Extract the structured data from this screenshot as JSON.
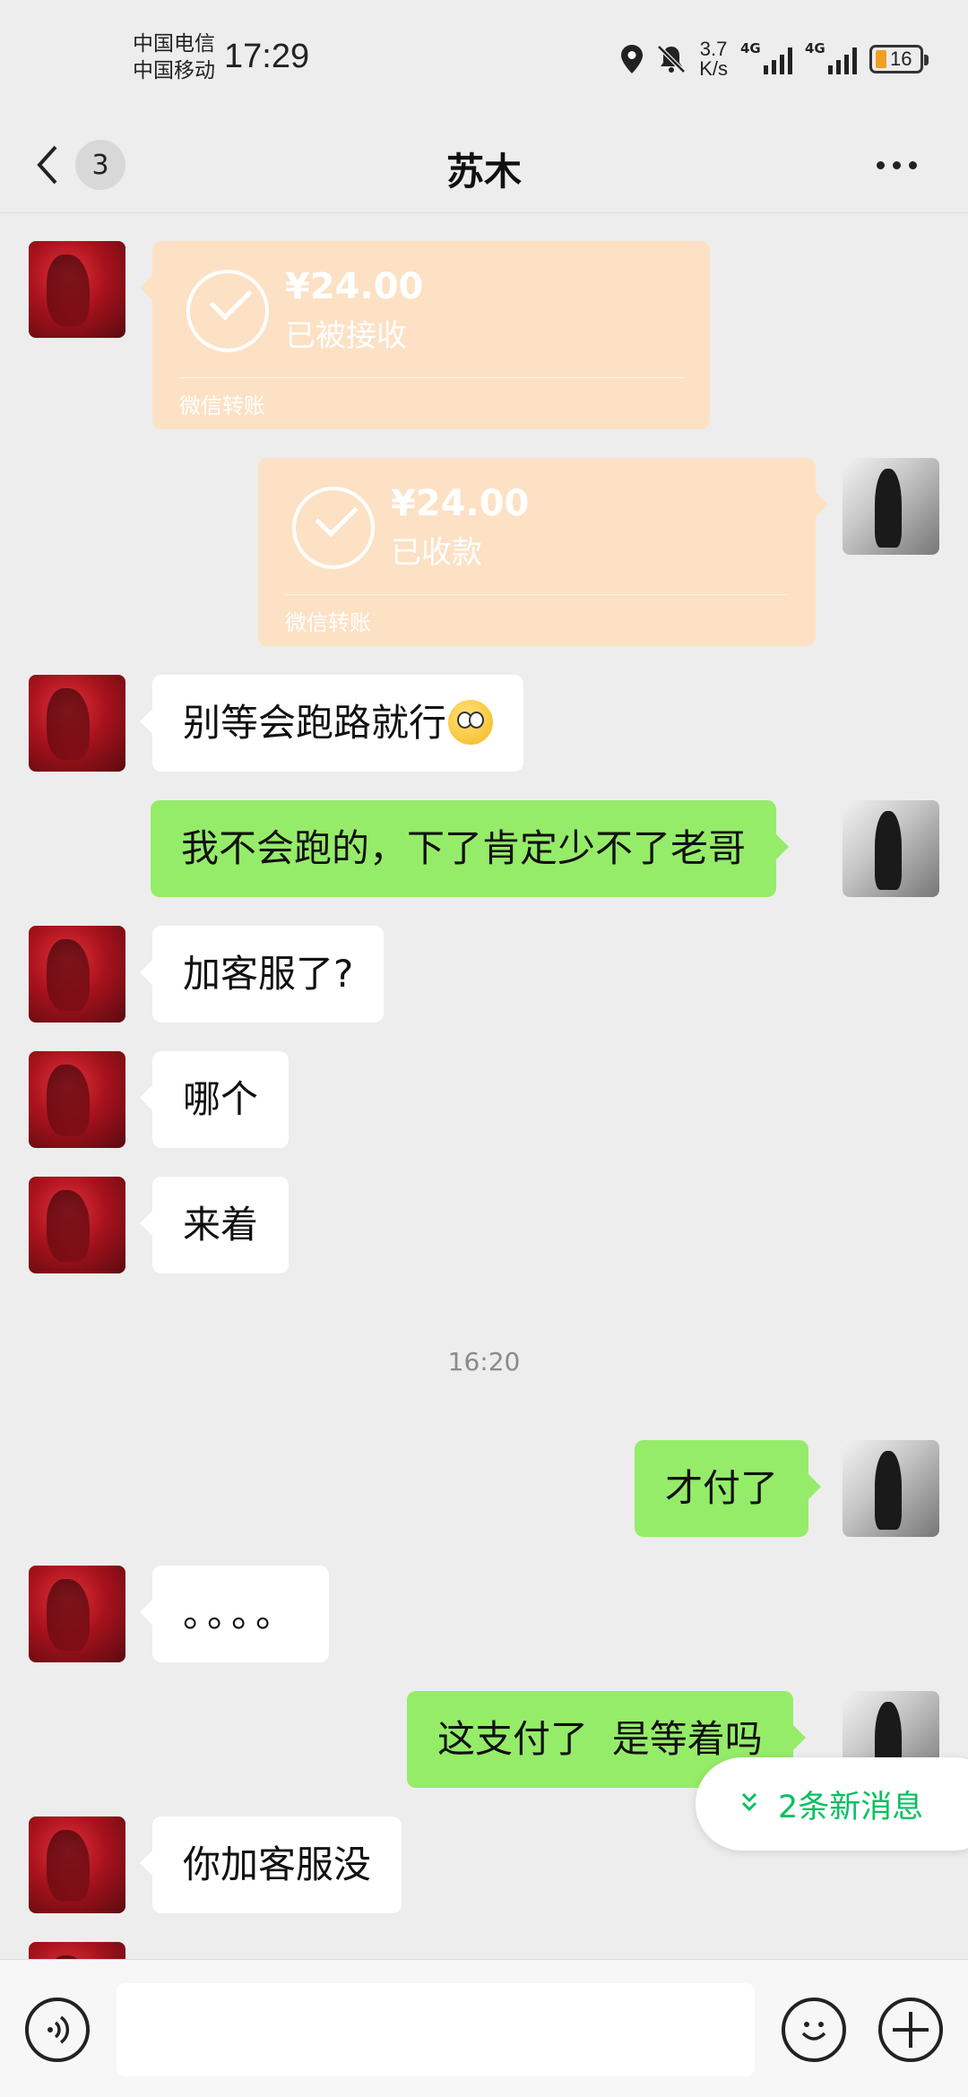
{
  "status_bar": {
    "carrier1": "中国电信",
    "carrier2": "中国移动",
    "time": "17:29",
    "net_speed_value": "3.7",
    "net_speed_unit": "K/s",
    "signal1_label": "4G",
    "signal2_label": "4G",
    "battery": "16",
    "icons": [
      "location-icon",
      "mute-bell-icon",
      "signal-icon",
      "battery-icon"
    ]
  },
  "header": {
    "unread_count": "3",
    "title": "苏木",
    "icons": [
      "back-chevron-icon",
      "more-dots-icon"
    ]
  },
  "messages": [
    {
      "side": "left",
      "type": "transfer",
      "amount": "¥24.00",
      "status": "已被接收",
      "footer": "微信转账"
    },
    {
      "side": "right",
      "type": "transfer",
      "amount": "¥24.00",
      "status": "已收款",
      "footer": "微信转账"
    },
    {
      "side": "left",
      "type": "text",
      "text": "别等会跑路就行",
      "emoji": "flushed-face-emoji"
    },
    {
      "side": "right",
      "type": "text",
      "text": "我不会跑的，下了肯定少不了老哥"
    },
    {
      "side": "left",
      "type": "text",
      "text": "加客服了?"
    },
    {
      "side": "left",
      "type": "text",
      "text": "哪个"
    },
    {
      "side": "left",
      "type": "text",
      "text": "来着"
    },
    {
      "type": "time",
      "text": "16:20"
    },
    {
      "side": "right",
      "type": "text",
      "text": "才付了"
    },
    {
      "side": "left",
      "type": "text",
      "text": "。。。。"
    },
    {
      "side": "right",
      "type": "text",
      "text": "这支付了  是等着吗"
    },
    {
      "side": "left",
      "type": "text",
      "text": "你加客服没"
    }
  ],
  "new_messages_pill": {
    "label": "2条新消息",
    "icon": "double-chevron-down-icon"
  },
  "input_bar": {
    "placeholder": "",
    "icons": [
      "voice-icon",
      "emoji-icon",
      "plus-icon"
    ]
  },
  "colors": {
    "background": "#ededed",
    "sent_bubble": "#95ec69",
    "received_bubble": "#ffffff",
    "transfer_bubble": "#fde1c5",
    "accent_green": "#07c160"
  }
}
